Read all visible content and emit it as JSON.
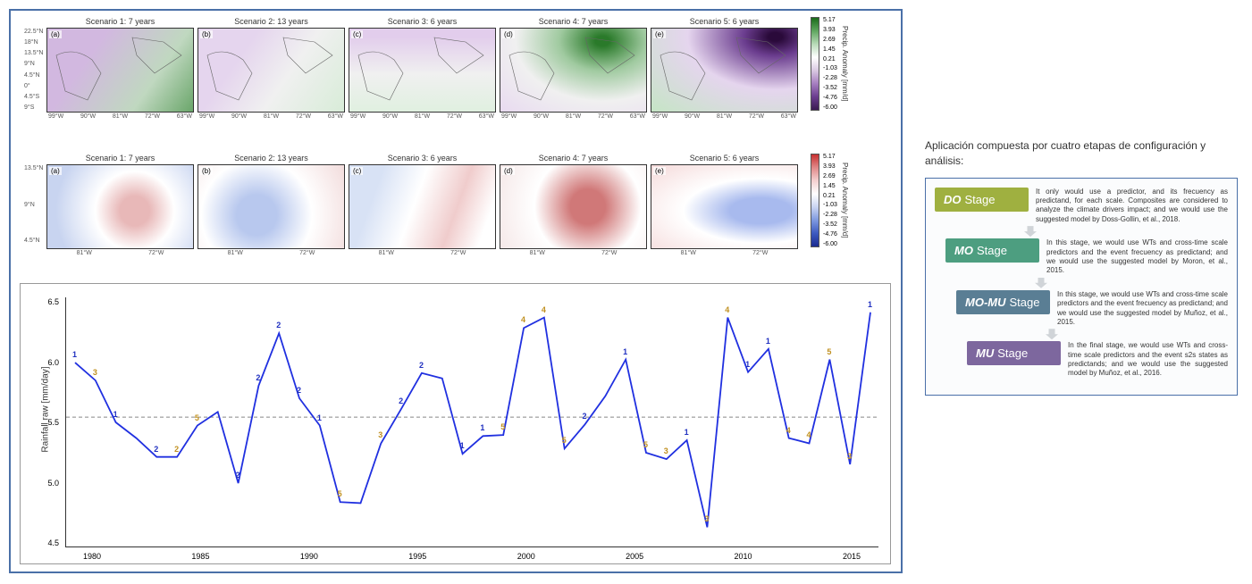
{
  "chart_data": [
    {
      "type": "heatmap",
      "group": "row1_maps",
      "subtitle_prefix": "Scenario",
      "scenarios": [
        {
          "num": 1,
          "years": 7,
          "label": "(a)"
        },
        {
          "num": 2,
          "years": 13,
          "label": "(b)"
        },
        {
          "num": 3,
          "years": 6,
          "label": "(c)"
        },
        {
          "num": 4,
          "years": 7,
          "label": "(d)"
        },
        {
          "num": 5,
          "years": 6,
          "label": "(e)"
        }
      ],
      "yticks": [
        "22.5°N",
        "18°N",
        "13.5°N",
        "9°N",
        "4.5°N",
        "0°",
        "4.5°S",
        "9°S"
      ],
      "xticks": [
        "99°W",
        "90°W",
        "81°W",
        "72°W",
        "63°W"
      ],
      "colorbar": {
        "label": "Precip. Anomaly [mm/d]",
        "ticks": [
          "5.17",
          "3.93",
          "2.69",
          "1.45",
          "0.21",
          "-1.03",
          "-2.28",
          "-3.52",
          "-4.76",
          "-6.00"
        ],
        "cmap": "PRGn"
      }
    },
    {
      "type": "heatmap",
      "group": "row2_maps",
      "scenarios": [
        {
          "num": 1,
          "years": 7,
          "label": "(a)"
        },
        {
          "num": 2,
          "years": 13,
          "label": "(b)"
        },
        {
          "num": 3,
          "years": 6,
          "label": "(c)"
        },
        {
          "num": 4,
          "years": 7,
          "label": "(d)"
        },
        {
          "num": 5,
          "years": 6,
          "label": "(e)"
        }
      ],
      "yticks": [
        "13.5°N",
        "9°N",
        "4.5°N"
      ],
      "xticks": [
        "81°W",
        "72°W"
      ],
      "colorbar": {
        "label": "Precip. Anomaly [mm/d]",
        "ticks": [
          "5.17",
          "3.93",
          "2.69",
          "1.45",
          "0.21",
          "-1.03",
          "-2.28",
          "-3.52",
          "-4.76",
          "-6.00"
        ],
        "cmap": "RdBu_r"
      }
    },
    {
      "type": "line",
      "name": "timeseries",
      "ylabel": "Rainfall raw [mm/day]",
      "ylim": [
        4.4,
        6.7
      ],
      "yticks": [
        "6.5",
        "6.0",
        "5.5",
        "5.0",
        "4.5"
      ],
      "xlim": [
        1978,
        2017
      ],
      "xticks": [
        "1980",
        "1985",
        "1990",
        "1995",
        "2000",
        "2005",
        "2010",
        "2015"
      ],
      "reference": 5.6,
      "x": [
        1978,
        1979,
        1980,
        1981,
        1982,
        1983,
        1984,
        1985,
        1986,
        1987,
        1988,
        1989,
        1990,
        1991,
        1992,
        1993,
        1994,
        1995,
        1996,
        1997,
        1998,
        1999,
        2000,
        2001,
        2002,
        2003,
        2004,
        2005,
        2006,
        2007,
        2008,
        2009,
        2010,
        2011,
        2012,
        2013,
        2014,
        2015,
        2016,
        2017
      ],
      "y": [
        6.12,
        5.95,
        5.55,
        5.4,
        5.22,
        5.22,
        5.52,
        5.65,
        4.97,
        5.9,
        6.4,
        5.78,
        5.52,
        4.79,
        4.78,
        5.35,
        5.68,
        6.02,
        5.97,
        5.25,
        5.42,
        5.43,
        6.45,
        6.55,
        5.3,
        5.53,
        5.8,
        6.15,
        5.26,
        5.2,
        5.38,
        4.55,
        6.55,
        6.03,
        6.25,
        5.4,
        5.35,
        6.15,
        5.15,
        6.6
      ],
      "annotations": [
        {
          "x": 1978,
          "y": 6.12,
          "t": "1",
          "c": 1
        },
        {
          "x": 1979,
          "y": 5.95,
          "t": "3",
          "c": 2
        },
        {
          "x": 1980,
          "y": 5.55,
          "t": "1",
          "c": 1
        },
        {
          "x": 1982,
          "y": 5.22,
          "t": "2",
          "c": 1
        },
        {
          "x": 1983,
          "y": 5.22,
          "t": "2",
          "c": 2
        },
        {
          "x": 1984,
          "y": 5.52,
          "t": "5",
          "c": 2
        },
        {
          "x": 1986,
          "y": 4.97,
          "t": "2",
          "c": 1
        },
        {
          "x": 1987,
          "y": 5.9,
          "t": "2",
          "c": 1
        },
        {
          "x": 1988,
          "y": 6.4,
          "t": "2",
          "c": 1
        },
        {
          "x": 1989,
          "y": 5.78,
          "t": "2",
          "c": 1
        },
        {
          "x": 1990,
          "y": 5.52,
          "t": "1",
          "c": 1
        },
        {
          "x": 1991,
          "y": 4.79,
          "t": "5",
          "c": 2
        },
        {
          "x": 1993,
          "y": 5.35,
          "t": "3",
          "c": 2
        },
        {
          "x": 1994,
          "y": 5.68,
          "t": "2",
          "c": 1
        },
        {
          "x": 1995,
          "y": 6.02,
          "t": "2",
          "c": 1
        },
        {
          "x": 1997,
          "y": 5.25,
          "t": "1",
          "c": 1
        },
        {
          "x": 1998,
          "y": 5.42,
          "t": "1",
          "c": 1
        },
        {
          "x": 1999,
          "y": 5.43,
          "t": "5",
          "c": 2
        },
        {
          "x": 2000,
          "y": 6.45,
          "t": "4",
          "c": 2
        },
        {
          "x": 2001,
          "y": 6.55,
          "t": "4",
          "c": 2
        },
        {
          "x": 2002,
          "y": 5.3,
          "t": "5",
          "c": 2
        },
        {
          "x": 2003,
          "y": 5.53,
          "t": "2",
          "c": 1
        },
        {
          "x": 2005,
          "y": 6.15,
          "t": "1",
          "c": 1
        },
        {
          "x": 2006,
          "y": 5.26,
          "t": "5",
          "c": 2
        },
        {
          "x": 2007,
          "y": 5.2,
          "t": "3",
          "c": 2
        },
        {
          "x": 2008,
          "y": 5.38,
          "t": "1",
          "c": 1
        },
        {
          "x": 2009,
          "y": 4.55,
          "t": "3",
          "c": 2
        },
        {
          "x": 2010,
          "y": 6.55,
          "t": "4",
          "c": 2
        },
        {
          "x": 2011,
          "y": 6.03,
          "t": "1",
          "c": 1
        },
        {
          "x": 2012,
          "y": 6.25,
          "t": "1",
          "c": 1
        },
        {
          "x": 2013,
          "y": 5.4,
          "t": "4",
          "c": 2
        },
        {
          "x": 2014,
          "y": 5.35,
          "t": "4",
          "c": 2
        },
        {
          "x": 2015,
          "y": 6.15,
          "t": "5",
          "c": 2
        },
        {
          "x": 2016,
          "y": 5.15,
          "t": "3",
          "c": 2
        },
        {
          "x": 2017,
          "y": 6.6,
          "t": "1",
          "c": 1
        }
      ]
    }
  ],
  "right": {
    "title": "Aplicación compuesta por cuatro etapas de configuración y análisis:",
    "stages": [
      {
        "abbr": "DO",
        "word": "Stage",
        "color": "#9fb040",
        "desc": "It only would use a predictor, and its frecuency as predictand, for each scale. Composites are considered to analyze the climate drivers impact; and we would use the suggested model by Doss-Gollin, et al., 2018."
      },
      {
        "abbr": "MO",
        "word": "Stage",
        "color": "#4d9e80",
        "desc": "In this stage, we would use WTs and cross-time scale predictors and the event frecuency as predictand; and we would use the suggested model by Moron, et al., 2015."
      },
      {
        "abbr": "MO-MU",
        "word": "Stage",
        "color": "#5a7e94",
        "desc": "In this stage, we would use WTs and cross-time scale predictors and the event frecuency as predictand; and we would use the suggested model by Muñoz, et al., 2015."
      },
      {
        "abbr": "MU",
        "word": "Stage",
        "color": "#7d679e",
        "desc": "In the final stage, we would use WTs and cross-time scale predictors and the event s2s states as predictands; and we would use the suggested model by Muñoz, et al., 2016."
      }
    ]
  }
}
